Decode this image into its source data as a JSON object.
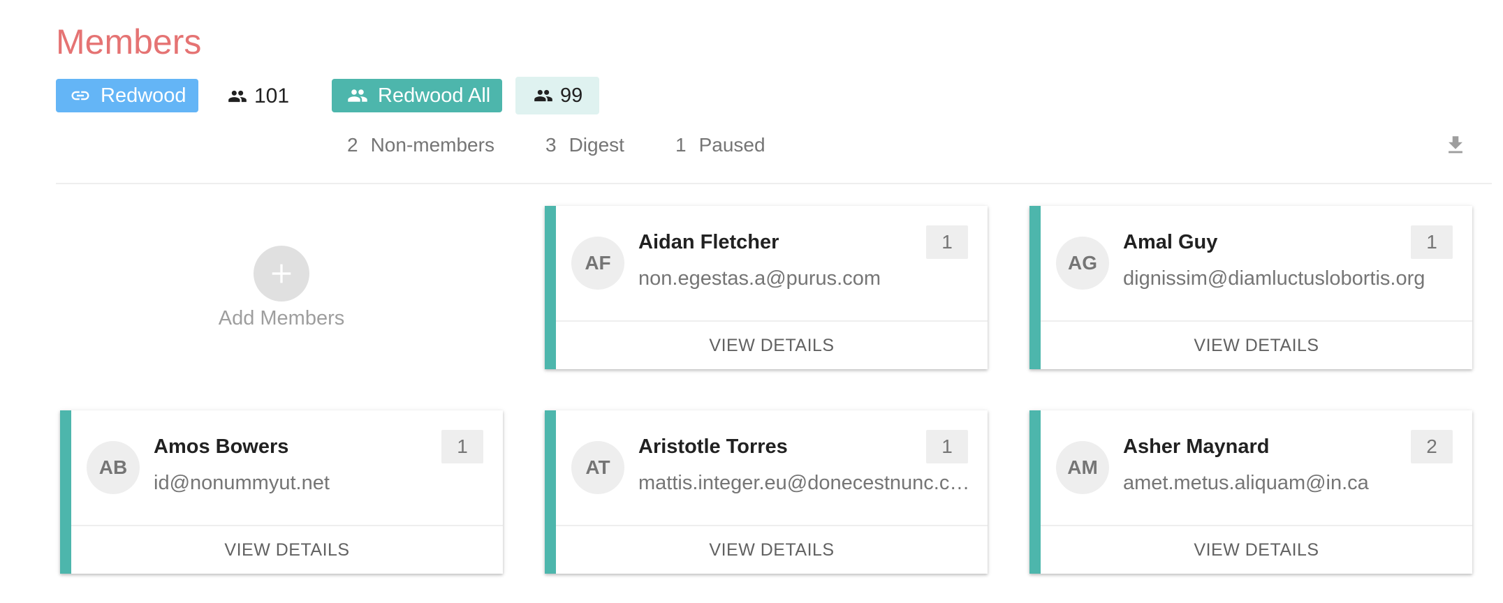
{
  "page": {
    "title": "Members"
  },
  "header": {
    "group_chip": {
      "label": "Redwood",
      "icon": "link-icon",
      "color": "#64b5f6"
    },
    "group_count": {
      "value": "101",
      "icon": "people-icon"
    },
    "all_chip": {
      "label": "Redwood All",
      "icon": "people-icon",
      "color": "#4db6ac"
    },
    "all_count": {
      "value": "99",
      "icon": "people-icon"
    }
  },
  "stats": [
    {
      "count": "2",
      "label": "Non-members"
    },
    {
      "count": "3",
      "label": "Digest"
    },
    {
      "count": "1",
      "label": "Paused"
    }
  ],
  "toolbar": {
    "download_icon": "download-icon"
  },
  "add_members": {
    "label": "Add Members",
    "icon": "plus-icon"
  },
  "card_accent_color": "#4db6ac",
  "members": [
    {
      "initials": "AF",
      "name": "Aidan Fletcher",
      "email": "non.egestas.a@purus.com",
      "count": "1",
      "action": "VIEW DETAILS"
    },
    {
      "initials": "AG",
      "name": "Amal Guy",
      "email": "dignissim@diamluctuslobortis.org",
      "count": "1",
      "action": "VIEW DETAILS"
    },
    {
      "initials": "AB",
      "name": "Amos Bowers",
      "email": "id@nonummyut.net",
      "count": "1",
      "action": "VIEW DETAILS"
    },
    {
      "initials": "AT",
      "name": "Aristotle Torres",
      "email": "mattis.integer.eu@donecestnunc.com",
      "count": "1",
      "action": "VIEW DETAILS"
    },
    {
      "initials": "AM",
      "name": "Asher Maynard",
      "email": "amet.metus.aliquam@in.ca",
      "count": "2",
      "action": "VIEW DETAILS"
    }
  ]
}
